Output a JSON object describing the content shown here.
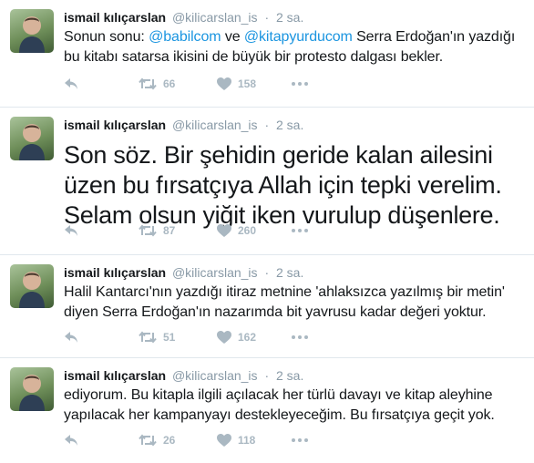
{
  "tweets": [
    {
      "fullname": "ismail kılıçarslan",
      "username": "@kilicarslan_is",
      "separator": "·",
      "time": "2 sa.",
      "text": {
        "p1": "Sonun sonu: ",
        "m1": "@babilcom",
        "p2": " ve ",
        "m2": "@kitapyurducom",
        "p3": " Serra Erdoğan'ın yazdığı bu kitabı satarsa ikisini de büyük bir protesto dalgası bekler."
      },
      "retweets": "66",
      "likes": "158"
    },
    {
      "fullname": "ismail kılıçarslan",
      "username": "@kilicarslan_is",
      "separator": "·",
      "time": "2 sa.",
      "text": "Son söz. Bir şehidin geride kalan ailesini üzen bu fırsatçıya Allah için tepki verelim. Selam olsun yiğit iken vurulup düşenlere.",
      "retweets": "87",
      "likes": "260"
    },
    {
      "fullname": "ismail kılıçarslan",
      "username": "@kilicarslan_is",
      "separator": "·",
      "time": "2 sa.",
      "text": "Halil Kantarcı'nın yazdığı itiraz metnine 'ahlaksızca yazılmış bir metin' diyen Serra Erdoğan'ın nazarımda bit yavrusu kadar değeri yoktur.",
      "retweets": "51",
      "likes": "162"
    },
    {
      "fullname": "ismail kılıçarslan",
      "username": "@kilicarslan_is",
      "separator": "·",
      "time": "2 sa.",
      "text": "ediyorum. Bu kitapla ilgili açılacak her türlü davayı ve kitap aleyhine yapılacak her kampanyayı destekleyeceğim. Bu fırsatçıya geçit yok.",
      "retweets": "26",
      "likes": "118"
    }
  ],
  "icons": {
    "reply": "reply-icon",
    "retweet": "retweet-icon",
    "like": "heart-icon",
    "more": "more-icon"
  },
  "colors": {
    "mention": "#1b95e0",
    "muted": "#8899a6",
    "action": "#aab8c2",
    "divider": "#e1e8ed"
  }
}
